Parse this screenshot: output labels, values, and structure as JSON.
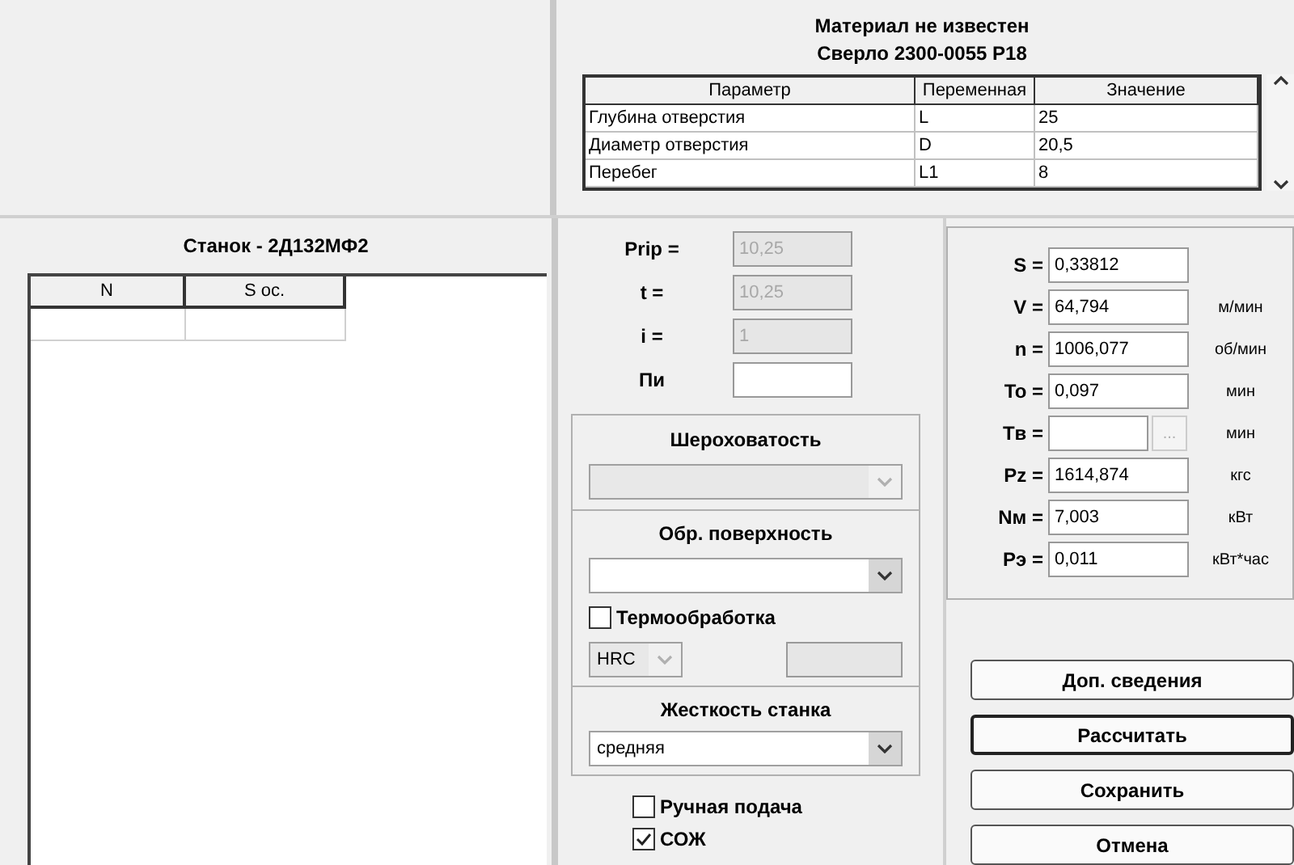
{
  "header": {
    "material": "Материал не известен",
    "tool": "Сверло 2300-0055 Р18"
  },
  "params": {
    "columns": [
      "Параметр",
      "Переменная",
      "Значение"
    ],
    "rows": [
      [
        "Глубина отверстия",
        "L",
        "25"
      ],
      [
        "Диаметр отверстия",
        "D",
        "20,5"
      ],
      [
        "Перебег",
        "L1",
        "8"
      ]
    ]
  },
  "machine_panel": {
    "title": "Станок - 2Д132МФ2",
    "columns": [
      "N",
      "S ос."
    ]
  },
  "inputs": [
    {
      "label": "Prip =",
      "value": "10,25",
      "disabled": true
    },
    {
      "label": "t =",
      "value": "10,25",
      "disabled": true
    },
    {
      "label": "i =",
      "value": "1",
      "disabled": true
    },
    {
      "label": "Пи",
      "disabled": false
    }
  ],
  "roughness": {
    "title": "Шероховатость",
    "disabled": true
  },
  "surface": {
    "title": "Обр. поверхность",
    "disabled": false
  },
  "heat_treatment": {
    "label": "Термообработка",
    "checked": false
  },
  "hardness": {
    "scale": "HRC",
    "disabled": true
  },
  "rigidity": {
    "title": "Жесткость станка",
    "value": "средняя"
  },
  "options": [
    {
      "label": "Ручная подача",
      "checked": false
    },
    {
      "label": "СОЖ",
      "checked": true
    }
  ],
  "results": [
    {
      "kind": "field",
      "label": "S =",
      "value": "0,33812"
    },
    {
      "kind": "field",
      "label": "V =",
      "value": "64,794",
      "unit": "м/мин"
    },
    {
      "kind": "field",
      "label": "n =",
      "value": "1006,077",
      "unit": "об/мин"
    },
    {
      "kind": "field",
      "label": "To =",
      "value": "0,097",
      "unit": "мин"
    },
    {
      "kind": "browse",
      "label": "Tв =",
      "button": "...",
      "unit": "мин"
    },
    {
      "kind": "field",
      "label": "Pz =",
      "value": "1614,874",
      "unit": "кгс"
    },
    {
      "kind": "field",
      "label": "Nм =",
      "value": "7,003",
      "unit": "кВт"
    },
    {
      "kind": "field",
      "label": "Pэ =",
      "value": "0,011",
      "unit": "кВт*час"
    }
  ],
  "buttons": [
    {
      "label": "Доп. сведения",
      "default": false
    },
    {
      "label": "Рассчитать",
      "default": true
    },
    {
      "label": "Сохранить",
      "default": false
    },
    {
      "label": "Отмена",
      "default": false
    }
  ]
}
